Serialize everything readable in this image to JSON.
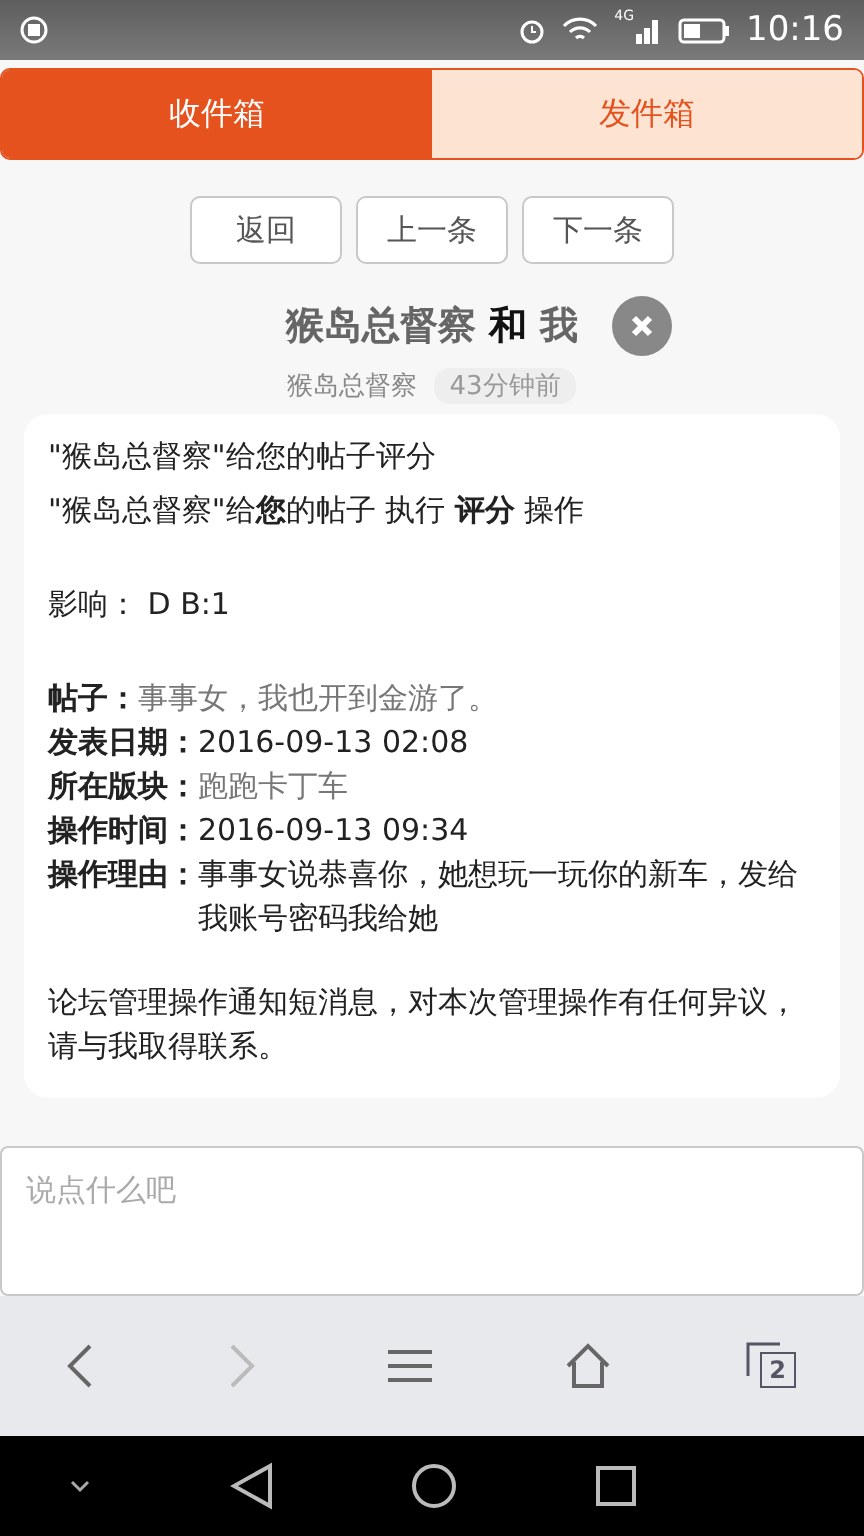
{
  "status_bar": {
    "network": "4G",
    "time": "10:16"
  },
  "tabs": [
    {
      "label": "收件箱",
      "selected": true
    },
    {
      "label": "发件箱",
      "selected": false
    }
  ],
  "nav_buttons": [
    "返回",
    "上一条",
    "下一条"
  ],
  "conversation": {
    "title_from": "猴岛总督察",
    "title_joiner": "和",
    "title_to": "我",
    "sender": "猴岛总督察",
    "time": "43分钟前"
  },
  "message": {
    "lines": [
      "\"猴岛总督察\"给您的帖子评分",
      "\"猴岛总督察\"给**您**的帖子 执行 **评分** 操作"
    ],
    "impact": "影响： D B:1",
    "fields": [
      {
        "label": "帖子：",
        "value": "事事女，我也开到金游了。",
        "kind": "link"
      },
      {
        "label": "发表日期：",
        "value": "2016-09-13 02:08",
        "kind": "text"
      },
      {
        "label": "所在版块：",
        "value": "跑跑卡丁车",
        "kind": "link"
      },
      {
        "label": "操作时间：",
        "value": "2016-09-13 09:34",
        "kind": "text"
      },
      {
        "label": "操作理由：",
        "value": "事事女说恭喜你，她想玩一玩你的新车，发给我账号密码我给她",
        "kind": "text"
      }
    ],
    "footer": "论坛管理操作通知短消息，对本次管理操作有任何异议，请与我取得联系。"
  },
  "reply": {
    "placeholder": "说点什么吧"
  },
  "browser_bar": {
    "tab_count": "2"
  }
}
